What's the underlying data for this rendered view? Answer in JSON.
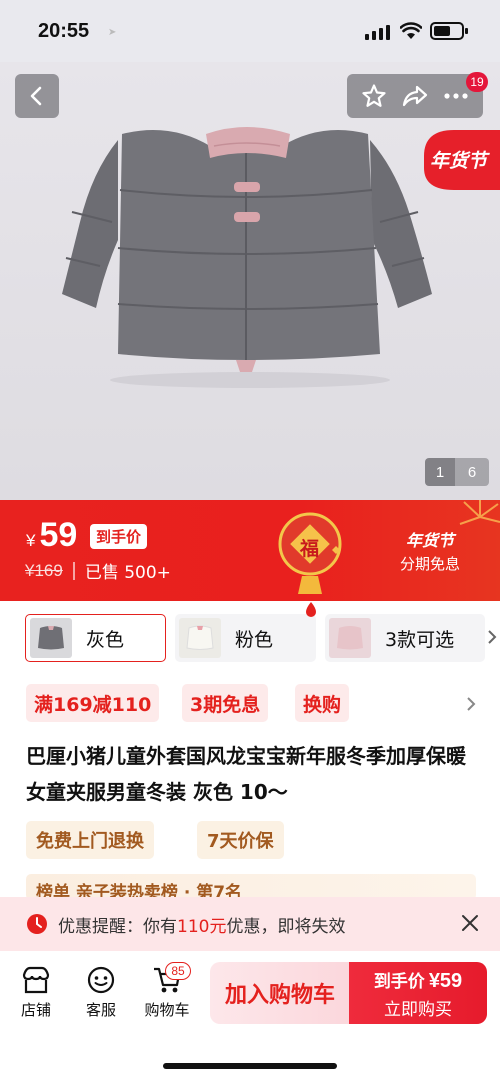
{
  "status_bar": {
    "time": "20:55"
  },
  "header": {
    "badge_count": "19",
    "nianhuo_tag": "年货节"
  },
  "gallery": {
    "current": "1",
    "total": "6"
  },
  "price_banner": {
    "currency": "¥",
    "price": "59",
    "price_tag": "到手价",
    "original_price": "¥169",
    "sold": "已售 500+",
    "fu_char": "福",
    "festival": "年货节",
    "installment": "分期免息"
  },
  "options": [
    {
      "label": "灰色"
    },
    {
      "label": "粉色"
    },
    {
      "label": "3款可选"
    }
  ],
  "promos": [
    "满169减110",
    "3期免息",
    "换购"
  ],
  "title": "巴厘小猪儿童外套国风龙宝宝新年服冬季加厚保暖女童夹服男童冬装 灰色 10～",
  "guarantees": [
    "免费上门退换",
    "7天价保"
  ],
  "rank_strip": "榜单  亲子装热卖榜 · 第7名",
  "reminder": {
    "prefix": "优惠提醒：你有",
    "amount": "110元",
    "suffix": "优惠，即将失效"
  },
  "bottom": {
    "store": "店铺",
    "service": "客服",
    "cart": "购物车",
    "cart_badge": "85",
    "add_cart": "加入购物车",
    "buy_price_label": "到手价",
    "buy_price": "¥59",
    "buy_now": "立即购买"
  },
  "colors": {
    "accent": "#e4211e",
    "promo_bg": "#fdeaea",
    "guarantee_text": "#a25a20"
  }
}
